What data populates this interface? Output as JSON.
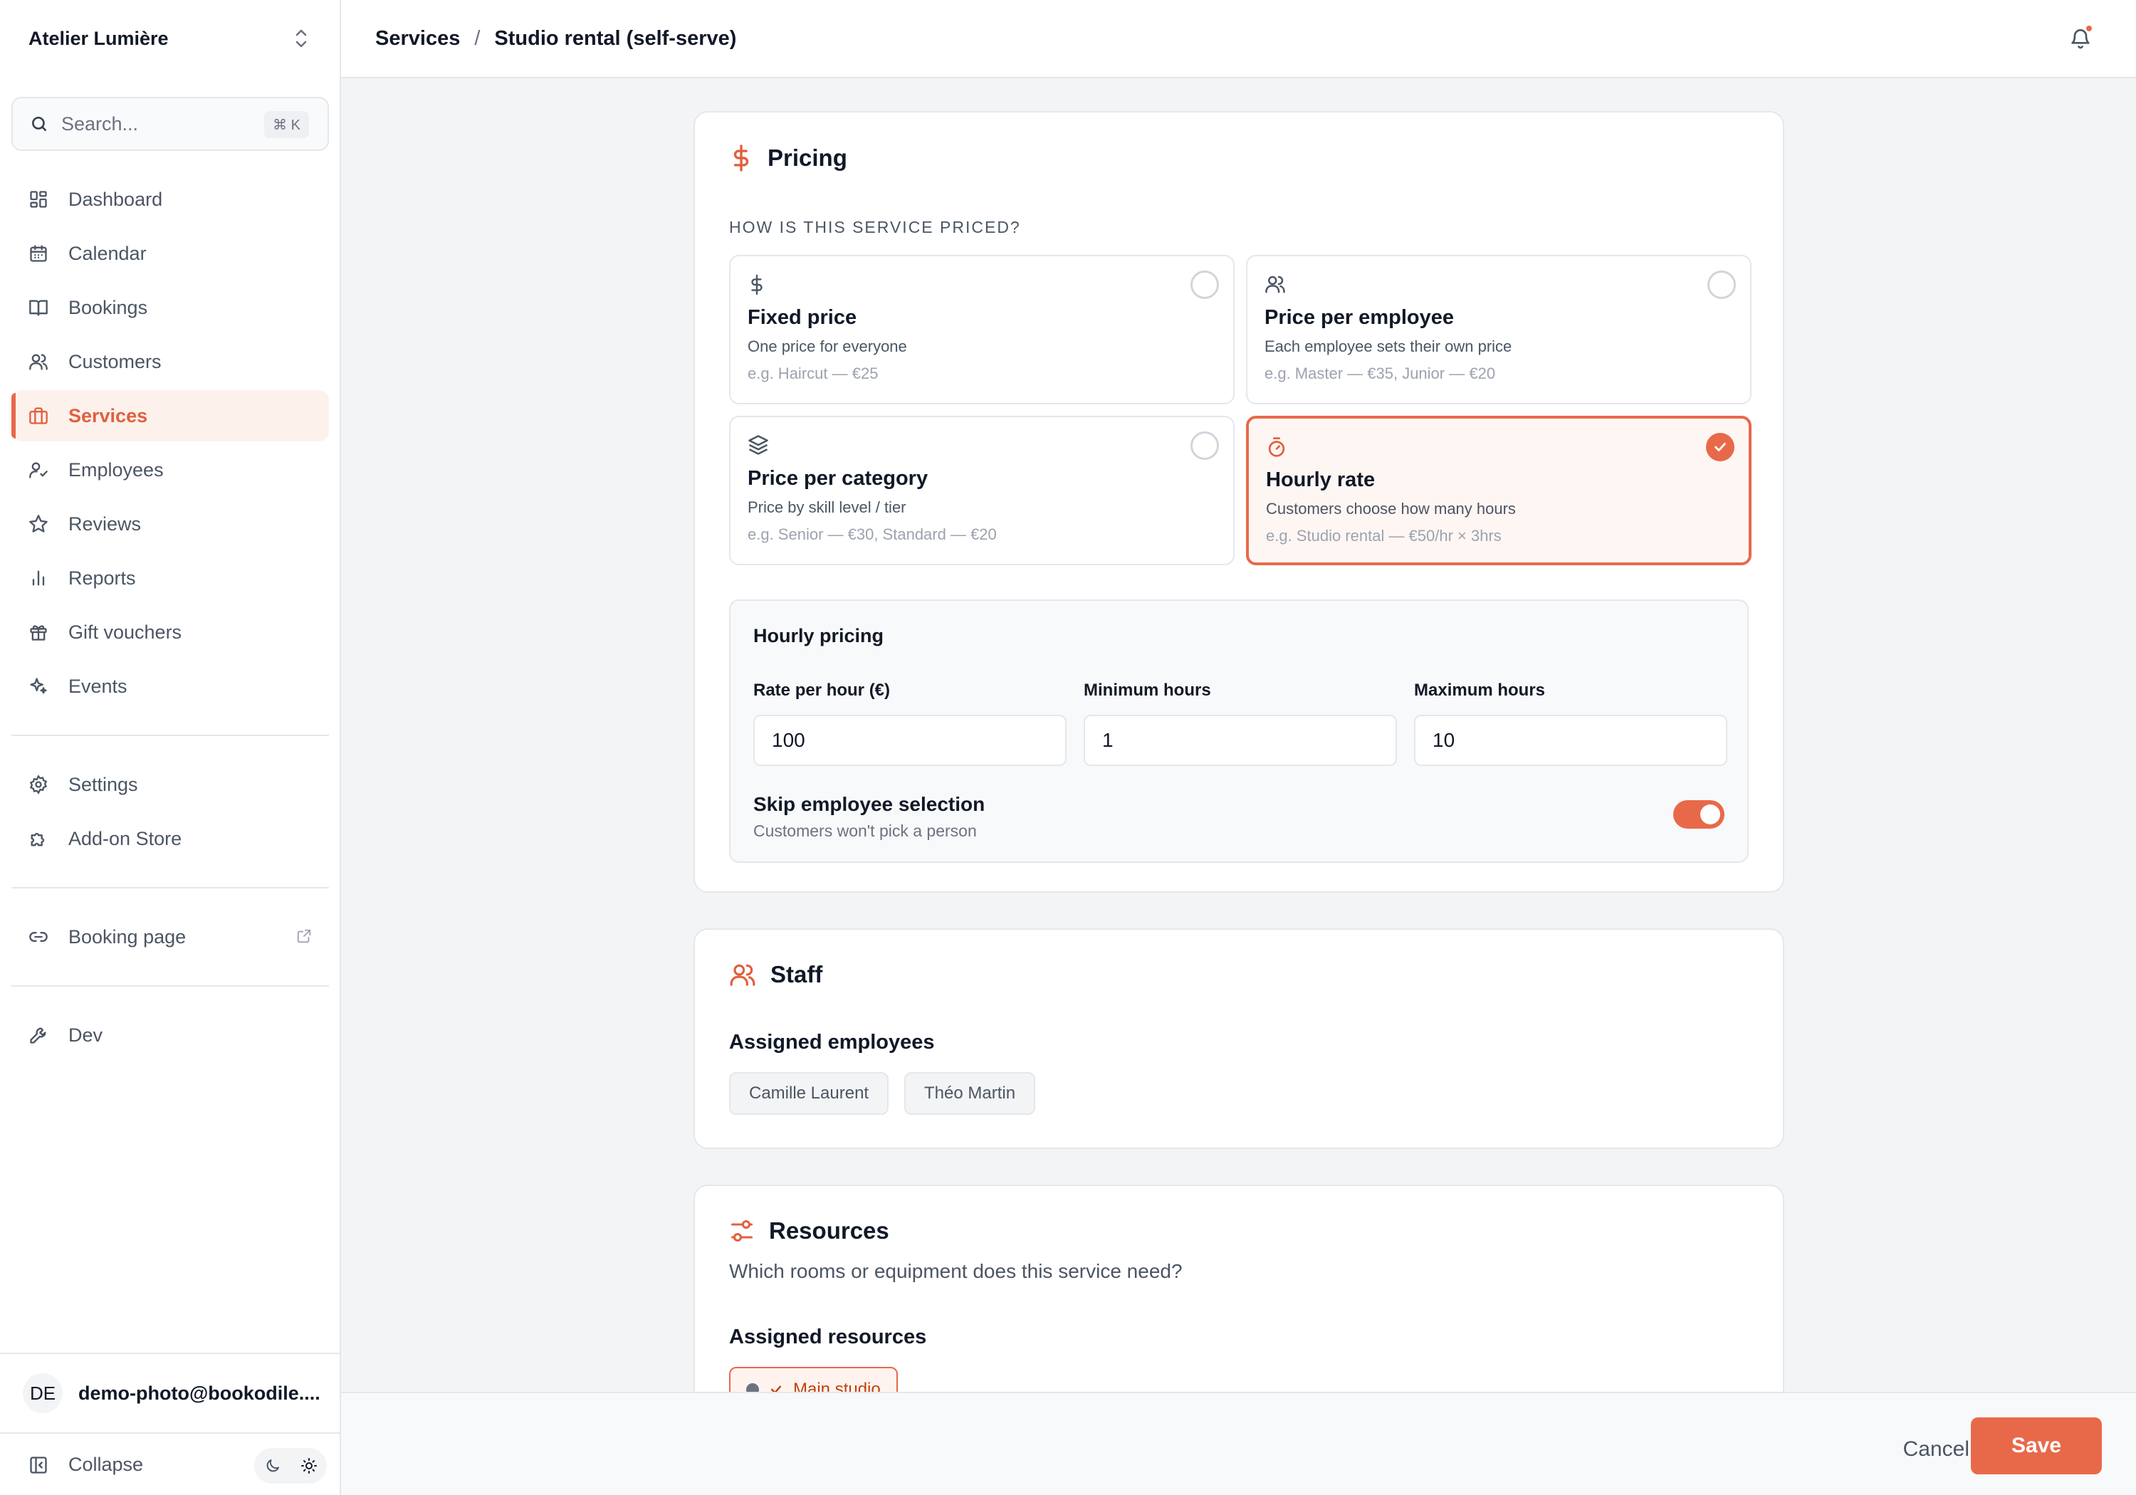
{
  "workspace": {
    "name": "Atelier Lumière"
  },
  "search": {
    "placeholder": "Search...",
    "shortcut": "⌘ K"
  },
  "sidebar": {
    "items": [
      {
        "label": "Dashboard",
        "icon": "dashboard-icon"
      },
      {
        "label": "Calendar",
        "icon": "calendar-icon"
      },
      {
        "label": "Bookings",
        "icon": "book-icon"
      },
      {
        "label": "Customers",
        "icon": "users-icon"
      },
      {
        "label": "Services",
        "icon": "briefcase-icon",
        "active": true
      },
      {
        "label": "Employees",
        "icon": "user-check-icon"
      },
      {
        "label": "Reviews",
        "icon": "star-icon"
      },
      {
        "label": "Reports",
        "icon": "bar-chart-icon"
      },
      {
        "label": "Gift vouchers",
        "icon": "gift-icon"
      },
      {
        "label": "Events",
        "icon": "sparkle-icon"
      }
    ],
    "secondary": [
      {
        "label": "Settings",
        "icon": "gear-icon"
      },
      {
        "label": "Add-on Store",
        "icon": "puzzle-icon"
      }
    ],
    "booking_page": {
      "label": "Booking page",
      "icon": "link-icon"
    },
    "dev": {
      "label": "Dev",
      "icon": "wrench-icon"
    },
    "user": {
      "initials": "DE",
      "email": "demo-photo@bookodile...."
    },
    "collapse_label": "Collapse"
  },
  "header": {
    "breadcrumb_parent": "Services",
    "breadcrumb_separator": "/",
    "breadcrumb_current": "Studio rental (self-serve)"
  },
  "pricing": {
    "title": "Pricing",
    "question": "HOW IS THIS SERVICE PRICED?",
    "options": [
      {
        "title": "Fixed price",
        "desc": "One price for everyone",
        "example": "e.g. Haircut — €25",
        "icon": "dollar-icon",
        "selected": false
      },
      {
        "title": "Price per employee",
        "desc": "Each employee sets their own price",
        "example": "e.g. Master — €35, Junior — €20",
        "icon": "users-icon",
        "selected": false
      },
      {
        "title": "Price per category",
        "desc": "Price by skill level / tier",
        "example": "e.g. Senior — €30, Standard — €20",
        "icon": "layers-icon",
        "selected": false
      },
      {
        "title": "Hourly rate",
        "desc": "Customers choose how many hours",
        "example": "e.g. Studio rental — €50/hr × 3hrs",
        "icon": "stopwatch-icon",
        "selected": true
      }
    ],
    "hourly": {
      "title": "Hourly pricing",
      "rate_label": "Rate per hour (€)",
      "rate_value": "100",
      "min_label": "Minimum hours",
      "min_value": "1",
      "max_label": "Maximum hours",
      "max_value": "10",
      "skip_title": "Skip employee selection",
      "skip_desc": "Customers won't pick a person",
      "skip_enabled": true
    }
  },
  "staff": {
    "title": "Staff",
    "assigned_label": "Assigned employees",
    "employees": [
      "Camille Laurent",
      "Théo Martin"
    ]
  },
  "resources": {
    "title": "Resources",
    "subtitle": "Which rooms or equipment does this service need?",
    "assigned_label": "Assigned resources",
    "items": [
      "Main studio"
    ]
  },
  "footer": {
    "cancel_label": "Cancel",
    "save_label": "Save"
  },
  "colors": {
    "accent": "#e8694a",
    "accent_bg": "#fef6f3",
    "page_bg": "#f3f4f6"
  }
}
